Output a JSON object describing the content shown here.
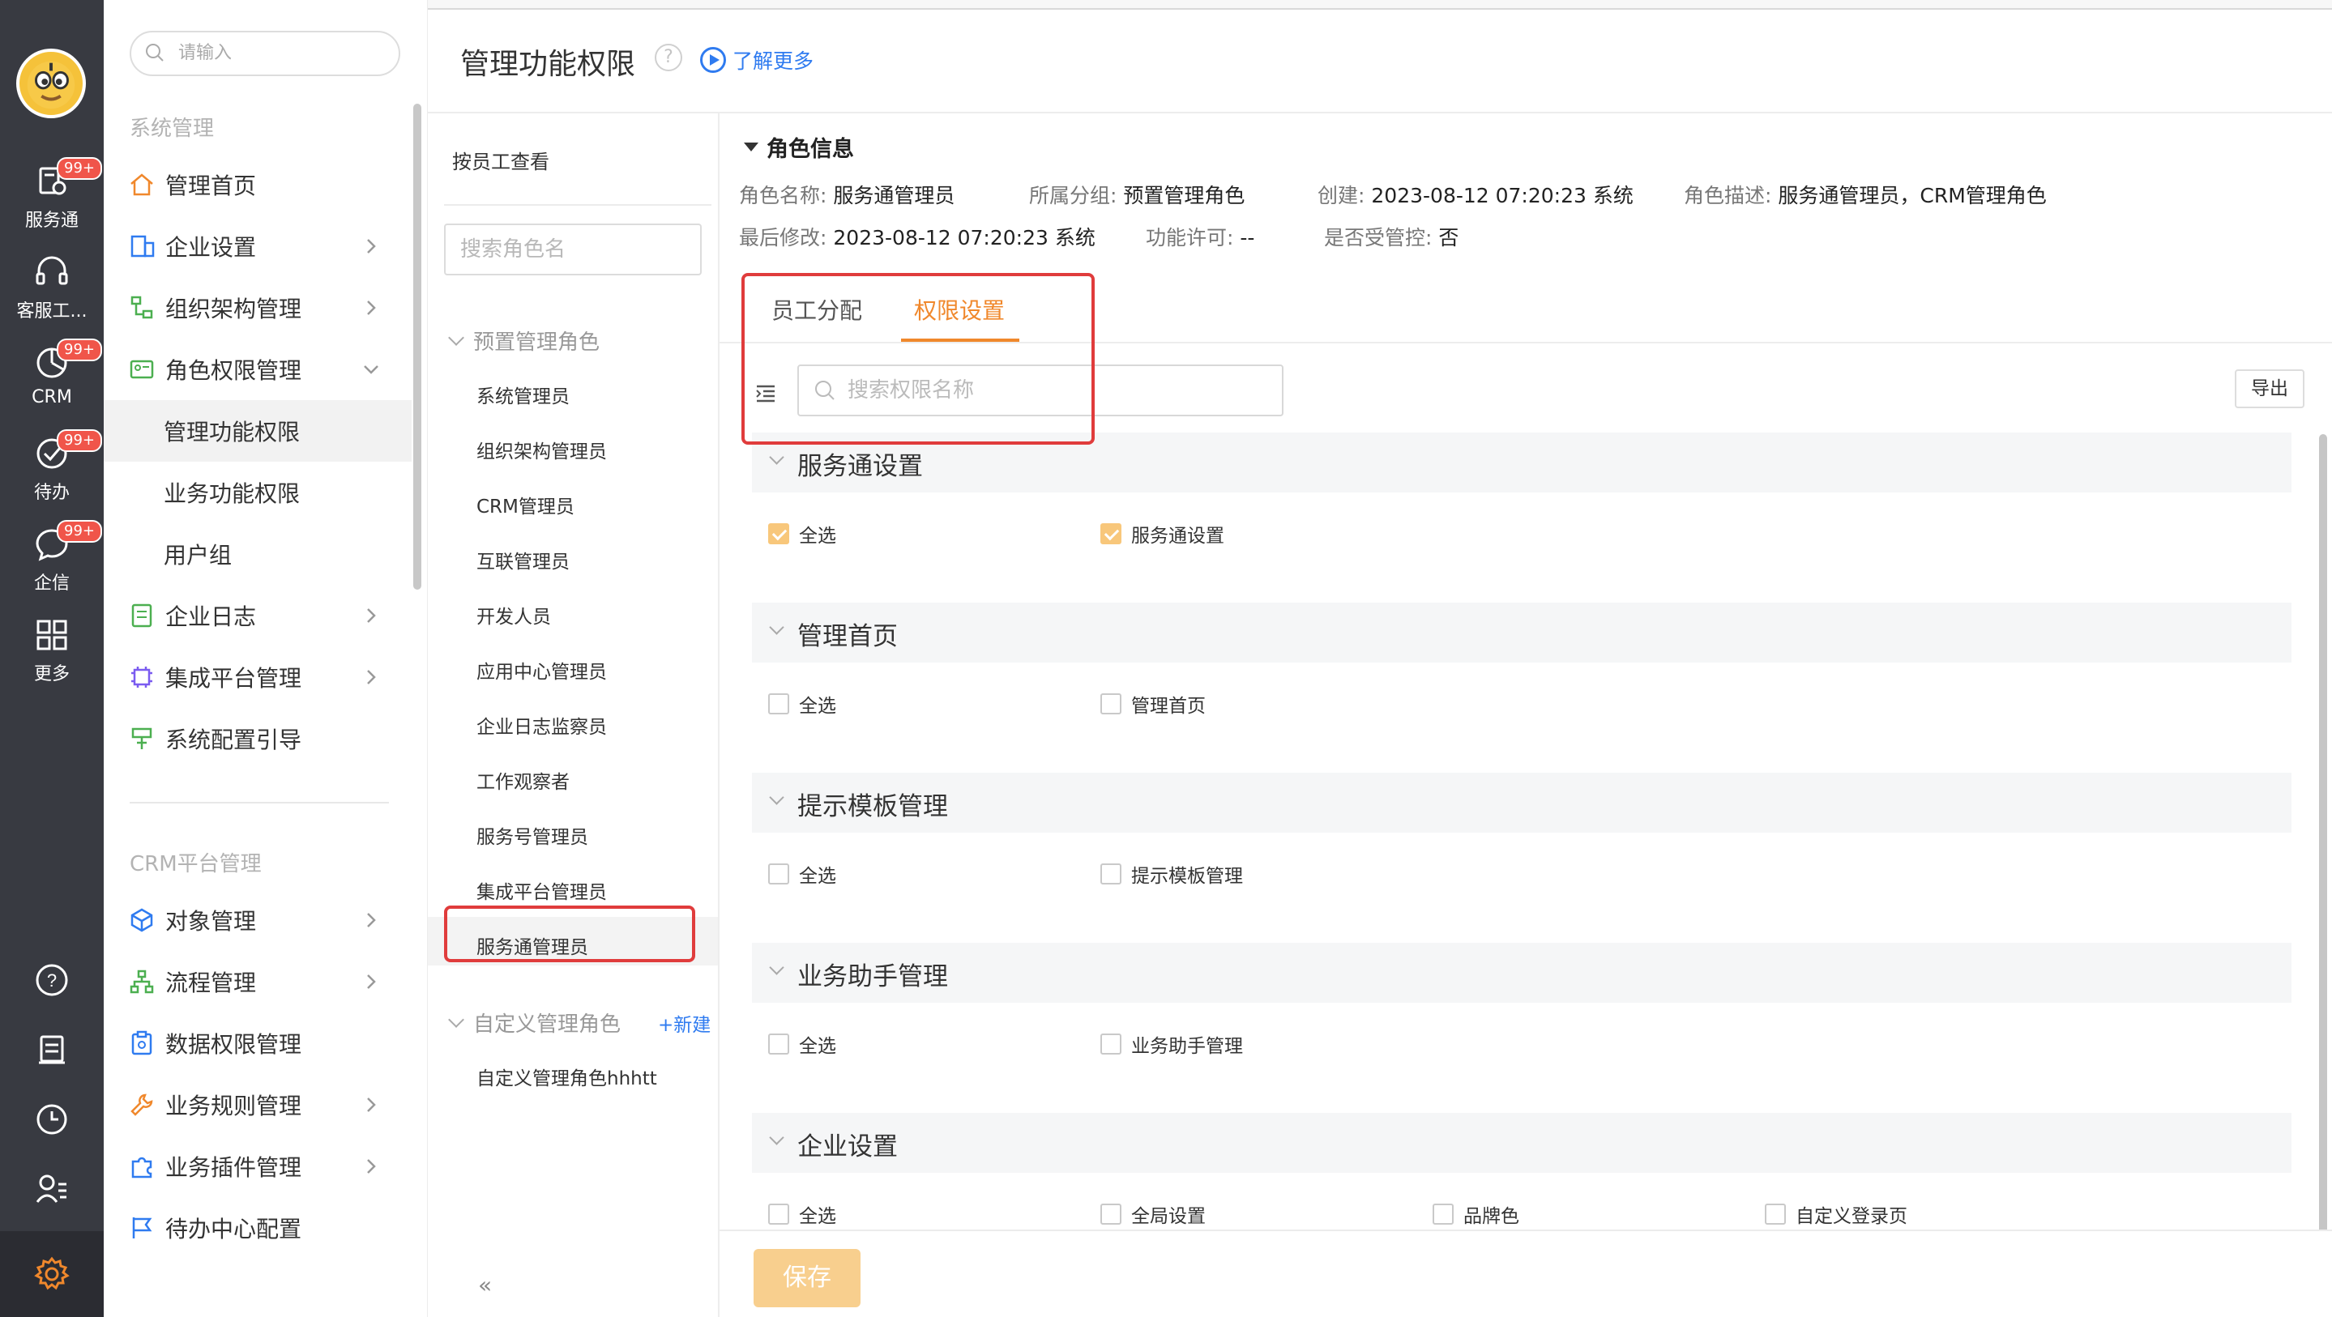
{
  "rail": {
    "items": [
      {
        "label": "服务通",
        "badge": "99+",
        "icon": "service-icon"
      },
      {
        "label": "客服工...",
        "badge": "",
        "icon": "headset-icon"
      },
      {
        "label": "CRM",
        "badge": "99+",
        "icon": "crm-chart-icon"
      },
      {
        "label": "待办",
        "badge": "99+",
        "icon": "check-circle-icon"
      },
      {
        "label": "企信",
        "badge": "99+",
        "icon": "chat-icon"
      },
      {
        "label": "更多",
        "badge": "",
        "icon": "grid-icon"
      }
    ],
    "bottom_icons": [
      "help-icon",
      "doc-icon",
      "clock-icon",
      "user-list-icon",
      "settings-icon"
    ],
    "accent": "#f0882c"
  },
  "nav": {
    "search_placeholder": "请输入",
    "section1": "系统管理",
    "items1": [
      {
        "label": "管理首页",
        "icon": "home-icon",
        "arrow": ""
      },
      {
        "label": "企业设置",
        "icon": "enterprise-icon",
        "arrow": "right"
      },
      {
        "label": "组织架构管理",
        "icon": "org-icon",
        "arrow": "right"
      },
      {
        "label": "角色权限管理",
        "icon": "role-card-icon",
        "arrow": "down"
      }
    ],
    "sub_items": [
      "管理功能权限",
      "业务功能权限",
      "用户组"
    ],
    "items2": [
      {
        "label": "企业日志",
        "icon": "log-icon",
        "arrow": "right"
      },
      {
        "label": "集成平台管理",
        "icon": "chip-icon",
        "arrow": "right"
      },
      {
        "label": "系统配置引导",
        "icon": "guide-icon",
        "arrow": ""
      }
    ],
    "section2": "CRM平台管理",
    "items3": [
      {
        "label": "对象管理",
        "icon": "cube-icon",
        "arrow": "right"
      },
      {
        "label": "流程管理",
        "icon": "flow-icon",
        "arrow": "right"
      },
      {
        "label": "数据权限管理",
        "icon": "data-perm-icon",
        "arrow": ""
      },
      {
        "label": "业务规则管理",
        "icon": "wrench-icon",
        "arrow": "right"
      },
      {
        "label": "业务插件管理",
        "icon": "puzzle-icon",
        "arrow": "right"
      },
      {
        "label": "待办中心配置",
        "icon": "flag-icon",
        "arrow": ""
      }
    ],
    "collapse": "«"
  },
  "header": {
    "title": "管理功能权限",
    "help": "?",
    "learn_more": "了解更多"
  },
  "roles": {
    "by_employee": "按员工查看",
    "search_placeholder": "搜索角色名",
    "group1": "预置管理角色",
    "list1": [
      "系统管理员",
      "组织架构管理员",
      "CRM管理员",
      "互联管理员",
      "开发人员",
      "应用中心管理员",
      "企业日志监察员",
      "工作观察者",
      "服务号管理员",
      "集成平台管理员",
      "服务通管理员"
    ],
    "selected": "服务通管理员",
    "group2": "自定义管理角色",
    "new": "+新建",
    "list2": [
      "自定义管理角色hhhtt"
    ]
  },
  "role_info": {
    "heading": "角色信息",
    "name_label": "角色名称:",
    "name": "服务通管理员",
    "group_label": "所属分组:",
    "group": "预置管理角色",
    "created_label": "创建:",
    "created": "2023-08-12 07:20:23 系统",
    "desc_label": "角色描述:",
    "desc": "服务通管理员，CRM管理角色",
    "modified_label": "最后修改:",
    "modified": "2023-08-12 07:20:23 系统",
    "license_label": "功能许可:",
    "license": "--",
    "controlled_label": "是否受管控:",
    "controlled": "否"
  },
  "tabs": {
    "assign": "员工分配",
    "perm": "权限设置",
    "active": "权限设置"
  },
  "perm_search_placeholder": "搜索权限名称",
  "export": "导出",
  "sections": [
    {
      "title": "服务通设置",
      "items": [
        {
          "label": "全选",
          "checked": true
        },
        {
          "label": "服务通设置",
          "checked": true
        }
      ]
    },
    {
      "title": "管理首页",
      "items": [
        {
          "label": "全选",
          "checked": false
        },
        {
          "label": "管理首页",
          "checked": false
        }
      ]
    },
    {
      "title": "提示模板管理",
      "items": [
        {
          "label": "全选",
          "checked": false
        },
        {
          "label": "提示模板管理",
          "checked": false
        }
      ]
    },
    {
      "title": "业务助手管理",
      "items": [
        {
          "label": "全选",
          "checked": false
        },
        {
          "label": "业务助手管理",
          "checked": false
        }
      ]
    },
    {
      "title": "企业设置",
      "items": [
        {
          "label": "全选",
          "checked": false
        },
        {
          "label": "全局设置",
          "checked": false
        },
        {
          "label": "品牌色",
          "checked": false
        },
        {
          "label": "自定义登录页",
          "checked": false
        }
      ]
    }
  ],
  "save": "保存"
}
